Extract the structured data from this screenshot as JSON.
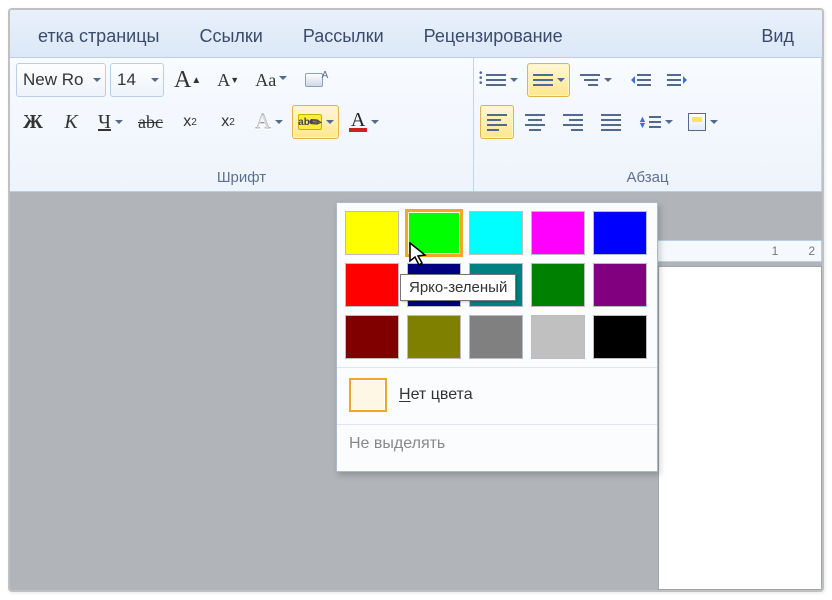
{
  "tabs": {
    "page_layout": "етка страницы",
    "references": "Ссылки",
    "mailings": "Рассылки",
    "review": "Рецензирование",
    "view": "Вид"
  },
  "font": {
    "name": "New Ro",
    "size": "14",
    "group_label": "Шрифт",
    "grow": "A",
    "shrink": "A",
    "case": "Aa",
    "bold": "Ж",
    "italic": "К",
    "underline": "Ч",
    "strike": "abc",
    "sub_base": "x",
    "sub_s": "2",
    "sup_base": "x",
    "sup_s": "2",
    "effects": "A",
    "highlight": "ab",
    "color": "A"
  },
  "paragraph": {
    "group_label": "Абзац"
  },
  "ruler": {
    "n1": "1",
    "n2": "2"
  },
  "color_picker": {
    "hovered_label": "Ярко-зеленый",
    "no_color_label": "Нет цвета",
    "no_color_underline": "Н",
    "no_color_rest": "ет цвета",
    "stop_highlight": "Не выделять",
    "row1": [
      "#ffff00",
      "#00ff00",
      "#00ffff",
      "#ff00ff",
      "#0000ff"
    ],
    "row2": [
      "#ff0000",
      "#000080",
      "#008080",
      "#008000",
      "#800080"
    ],
    "row3": [
      "#800000",
      "#808000",
      "#808080",
      "#c0c0c0",
      "#000000"
    ]
  }
}
